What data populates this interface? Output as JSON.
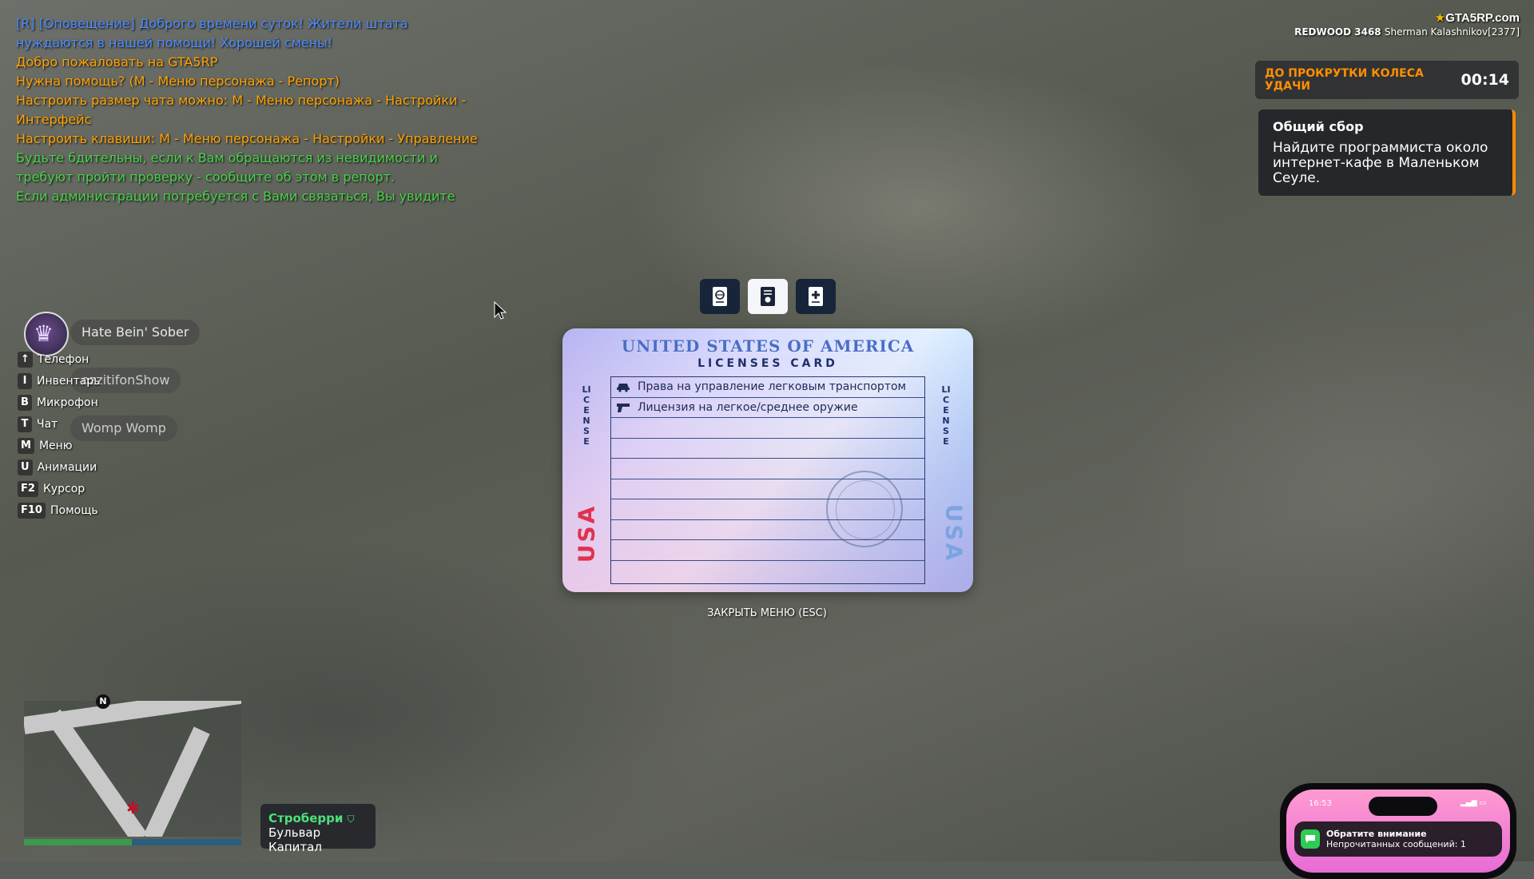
{
  "chat": [
    {
      "text": "[R] [Оповещение] Доброго времени суток! Жители штата",
      "color": "blue"
    },
    {
      "text": "нуждаются в нашей помощи! Хорошей смены!",
      "color": "blue"
    },
    {
      "text": "Добро пожаловать на GTA5RP",
      "color": "orange"
    },
    {
      "text": "Нужна помощь? (M - Меню персонажа - Репорт)",
      "color": "orange"
    },
    {
      "text": "Настроить размер чата можно: M - Меню персонажа - Настройки -",
      "color": "orange"
    },
    {
      "text": "Интерфейс",
      "color": "orange"
    },
    {
      "text": "Настроить клавиши: M - Меню персонажа - Настройки - Управление",
      "color": "orange"
    },
    {
      "text": "Будьте бдительны, если к Вам обращаются из невидимости и",
      "color": "green"
    },
    {
      "text": "требуют пройти проверку - сообщите об этом в репорт.",
      "color": "green"
    },
    {
      "text": "Если администрации потребуется с Вами связаться, Вы увидите",
      "color": "green"
    }
  ],
  "brand": {
    "logo": "GTA5RP.com",
    "server": "REDWOOD 3468",
    "player": "Sherman Kalashnikov[2377]"
  },
  "wheel": {
    "label": "ДО ПРОКРУТКИ КОЛЕСА УДАЧИ",
    "time": "00:14"
  },
  "quest": {
    "title": "Общий сбор",
    "text": "Найдите программиста около интернет-кафе в Маленьком Сеуле."
  },
  "voice": {
    "tags": [
      "Hate Bein' Sober",
      "ozzitifonShow",
      "Womp Womp"
    ]
  },
  "keys": [
    {
      "key": "↑",
      "label": "Телефон"
    },
    {
      "key": "I",
      "label": "Инвентарь"
    },
    {
      "key": "B",
      "label": "Микрофон"
    },
    {
      "key": "T",
      "label": "Чат"
    },
    {
      "key": "M",
      "label": "Меню"
    },
    {
      "key": "U",
      "label": "Анимации"
    },
    {
      "key": "F2",
      "label": "Курсор"
    },
    {
      "key": "F10",
      "label": "Помощь"
    }
  ],
  "license_tabs": [
    {
      "icon": "passport-icon",
      "active": false
    },
    {
      "icon": "license-icon",
      "active": true
    },
    {
      "icon": "medical-card-icon",
      "active": false
    }
  ],
  "card": {
    "title": "UNITED STATES OF AMERICA",
    "subtitle": "LICENSES CARD",
    "side_word": "LICENSE",
    "country": "USA",
    "licenses": [
      {
        "icon": "car-icon",
        "text": "Права на управление легковым транспортом"
      },
      {
        "icon": "pistol-icon",
        "text": "Лицензия на легкое/среднее оружие"
      }
    ],
    "empty_rows": 8
  },
  "close_hint": "ЗАКРЫТЬ МЕНЮ (ESC)",
  "minimap": {
    "compass": "N"
  },
  "location": {
    "zone": "Строберри",
    "street": "Бульвар Капитал"
  },
  "phone": {
    "time": "16:53",
    "notification_title": "Обратите внимание",
    "notification_body": "Непрочитанных сообщений: 1"
  },
  "colors": {
    "chat_blue": "#4d8bff",
    "chat_orange": "#ffa200",
    "chat_green": "#4bd14b",
    "accent_orange": "#ff8a00",
    "zone_green": "#4ee07a"
  }
}
